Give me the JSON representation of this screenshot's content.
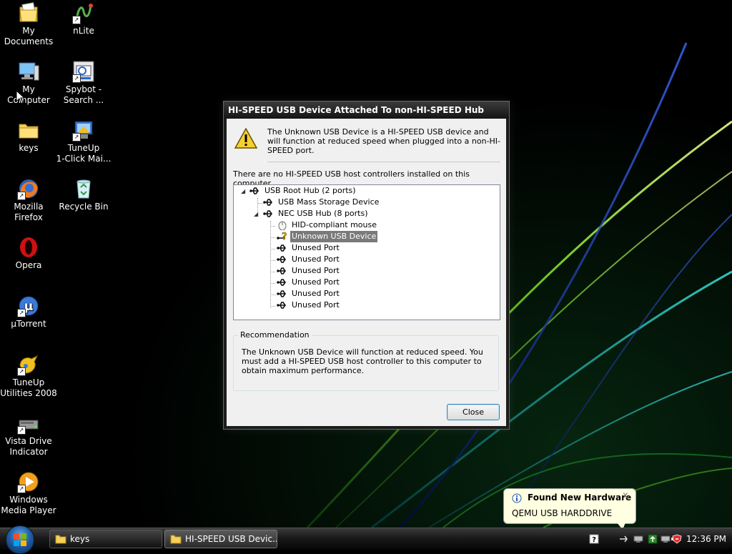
{
  "desktop": {
    "icons": [
      {
        "label": "My\nDocuments",
        "icon": "my-documents-icon"
      },
      {
        "label": "nLite",
        "icon": "nlite-icon"
      },
      {
        "label": "My Computer",
        "icon": "my-computer-icon"
      },
      {
        "label": "Spybot -\nSearch ...",
        "icon": "spybot-icon"
      },
      {
        "label": "keys",
        "icon": "folder-icon"
      },
      {
        "label": "TuneUp\n1-Click Mai...",
        "icon": "tuneup-1click-icon"
      },
      {
        "label": "Mozilla\nFirefox",
        "icon": "firefox-icon"
      },
      {
        "label": "Recycle Bin",
        "icon": "recycle-bin-icon"
      },
      {
        "label": "Opera",
        "icon": "opera-icon"
      },
      {
        "label": "µTorrent",
        "icon": "utorrent-icon"
      },
      {
        "label": "TuneUp\nUtilities 2008",
        "icon": "tuneup-utilities-icon"
      },
      {
        "label": "Vista Drive\nIndicator",
        "icon": "vista-drive-indicator-icon"
      },
      {
        "label": "Windows\nMedia Player",
        "icon": "windows-media-player-icon"
      }
    ]
  },
  "dialog": {
    "title": "HI-SPEED USB Device Attached To non-HI-SPEED Hub",
    "message": "The Unknown USB Device is a HI-SPEED USB device and will function at reduced speed when plugged into a non-HI-SPEED port.",
    "no_controllers": "There are no HI-SPEED USB host controllers installed on this computer.",
    "tree": {
      "root": "USB Root Hub (2 ports)",
      "mass_storage": "USB Mass Storage Device",
      "nec_hub": "NEC USB Hub (8 ports)",
      "hid_mouse": "HID-compliant mouse",
      "unknown": "Unknown USB Device",
      "unused_ports": [
        "Unused Port",
        "Unused Port",
        "Unused Port",
        "Unused Port",
        "Unused Port",
        "Unused Port"
      ]
    },
    "recommendation_title": "Recommendation",
    "recommendation": "The Unknown USB Device will function at reduced speed. You must add a HI-SPEED USB host controller to this computer to obtain maximum performance.",
    "close_label": "Close"
  },
  "balloon": {
    "title": "Found New Hardware",
    "text": "QEMU USB HARDDRIVE",
    "close": "x"
  },
  "taskbar": {
    "buttons": [
      {
        "label": "keys",
        "icon": "folder-icon",
        "active": false
      },
      {
        "label": "HI-SPEED USB Devic...",
        "icon": "folder-icon",
        "active": true
      }
    ],
    "clock": "12:36 PM",
    "tray": [
      "help-icon",
      "usb-hardware-icon",
      "network-icon",
      "network-green-icon",
      "network-icon",
      "volume-icon",
      "security-shield-icon"
    ]
  }
}
